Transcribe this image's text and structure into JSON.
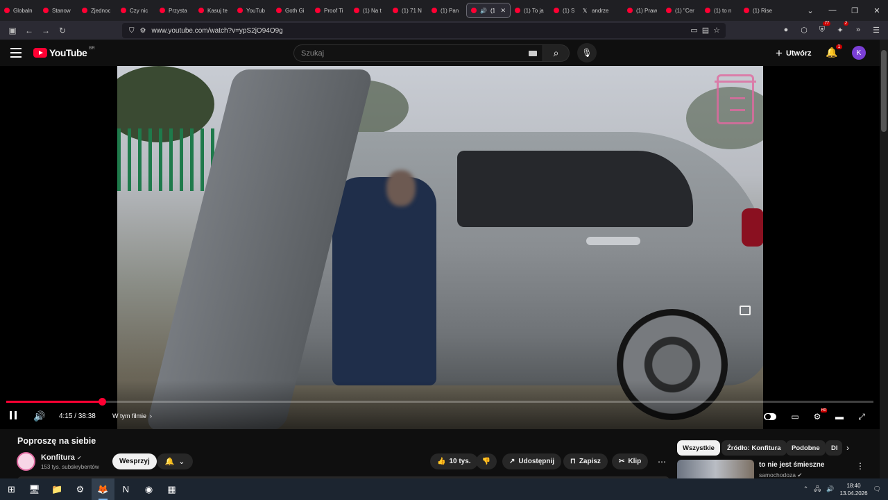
{
  "browser": {
    "tabs": [
      {
        "label": "Globaln"
      },
      {
        "label": "Stanow"
      },
      {
        "label": "Zjednoc"
      },
      {
        "label": "Czy nic"
      },
      {
        "label": "Przysta"
      },
      {
        "label": "Kasuj te"
      },
      {
        "label": "YouTub"
      },
      {
        "label": "Goth Gi"
      },
      {
        "label": "Proof Ti"
      },
      {
        "label": "(1) Na t"
      },
      {
        "label": "(1) 71 N"
      },
      {
        "label": "(1) Pan"
      },
      {
        "label": "(1) K",
        "active": true
      },
      {
        "label": "(1) To ja"
      },
      {
        "label": "(1) STAT"
      },
      {
        "label": "andrze"
      },
      {
        "label": "(1) Praw"
      },
      {
        "label": "(1) \"Cer"
      },
      {
        "label": "(1) to n"
      },
      {
        "label": "(1) Rise"
      }
    ],
    "url": "www.youtube.com/watch?v=ypS2jO94O9g",
    "ext_badge_1": "77",
    "ext_badge_2": "2"
  },
  "youtube": {
    "logo_text": "YouTube",
    "country_code": "BR",
    "search_placeholder": "Szukaj",
    "create_label": "Utwórz",
    "notif_count": "1",
    "avatar_letter": "K"
  },
  "player": {
    "current_time": "4:15",
    "duration": "38:38",
    "time_display": "4:15 / 38:38",
    "progress_fraction": 0.11,
    "chapter_label": "W tym filmie",
    "hd_badge": "HD"
  },
  "video": {
    "title": "Poproszę na siebie",
    "channel": "Konfitura",
    "subscribers": "153 tys. subskrybentów",
    "support_label": "Wesprzyj",
    "likes": "10 tys.",
    "share_label": "Udostępnij",
    "save_label": "Zapisz",
    "clip_label": "Klip"
  },
  "sidebar": {
    "chips": [
      "Wszystkie",
      "Źródło: Konfitura",
      "Podobne",
      "Dl"
    ],
    "rec_title": "to nie jest śmieszne",
    "rec_channel": "samochodoza"
  },
  "system": {
    "time": "18:40",
    "date": "13.04.2026"
  },
  "colors": {
    "youtube_red": "#ff0033",
    "background": "#0f0f0f",
    "avatar": "#7b3fd6"
  }
}
